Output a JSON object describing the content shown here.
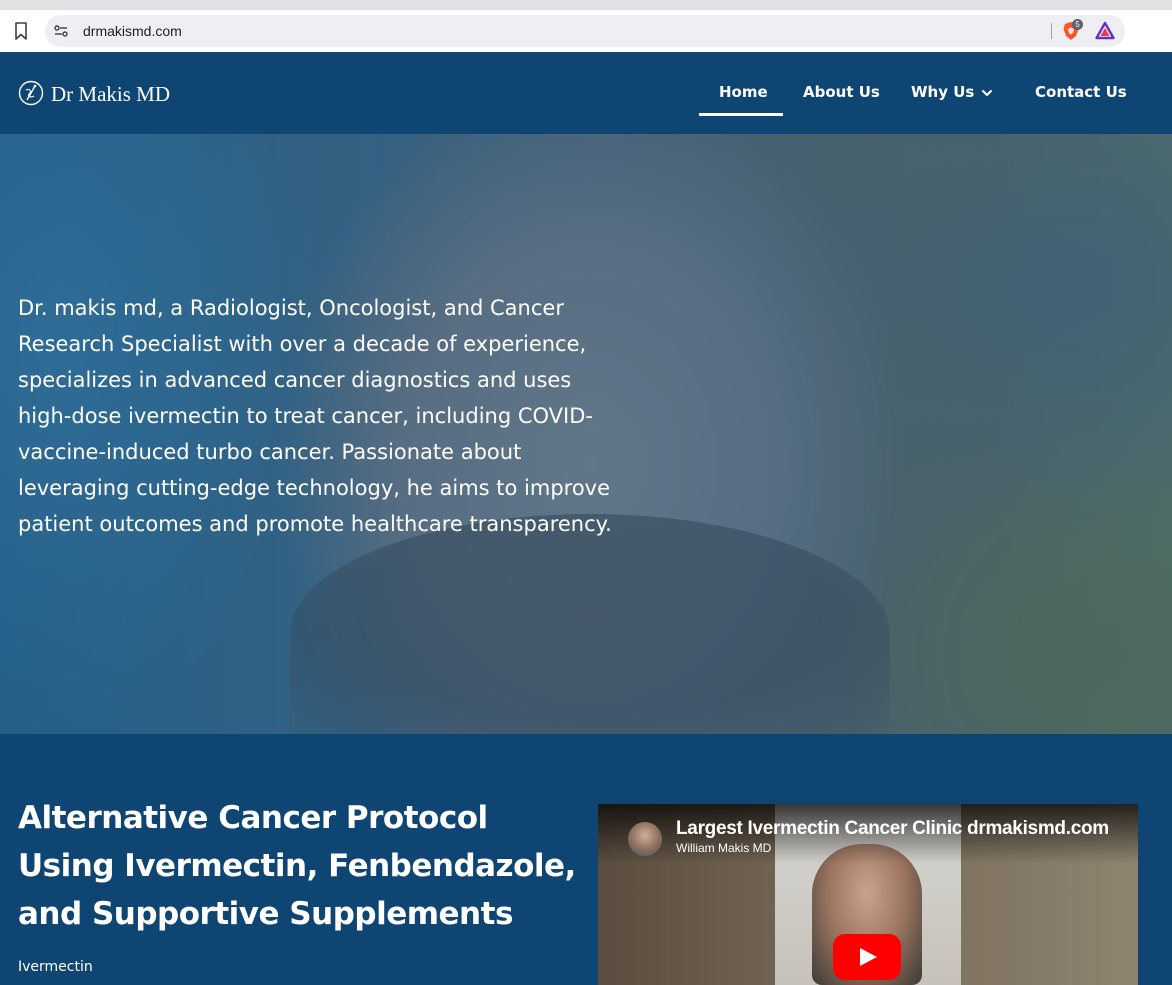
{
  "browser": {
    "url": "drmakismd.com",
    "shields_count": "5"
  },
  "site": {
    "logo_text": "Dr Makis MD"
  },
  "nav": {
    "items": [
      {
        "label": "Home",
        "active": true
      },
      {
        "label": "About Us"
      },
      {
        "label": "Why Us",
        "has_dropdown": true
      },
      {
        "label": "Contact Us"
      }
    ]
  },
  "hero": {
    "text": "Dr. makis md, a Radiologist, Oncologist, and Cancer Research Specialist with over a decade of experience, specializes in advanced cancer diagnostics and uses high-dose ivermectin to treat cancer, including COVID-vaccine-induced turbo cancer. Passionate about leveraging cutting-edge technology, he aims to improve patient outcomes and promote healthcare transparency."
  },
  "section": {
    "title": "Alternative Cancer Protocol Using Ivermectin, Fenbendazole, and Supportive Supplements",
    "subtitle": "Ivermectin"
  },
  "video": {
    "title": "Largest Ivermectin Cancer Clinic drmakismd.com",
    "channel": "William Makis MD"
  },
  "colors": {
    "brand_navy": "#0f4573",
    "youtube_red": "#ff0000"
  }
}
